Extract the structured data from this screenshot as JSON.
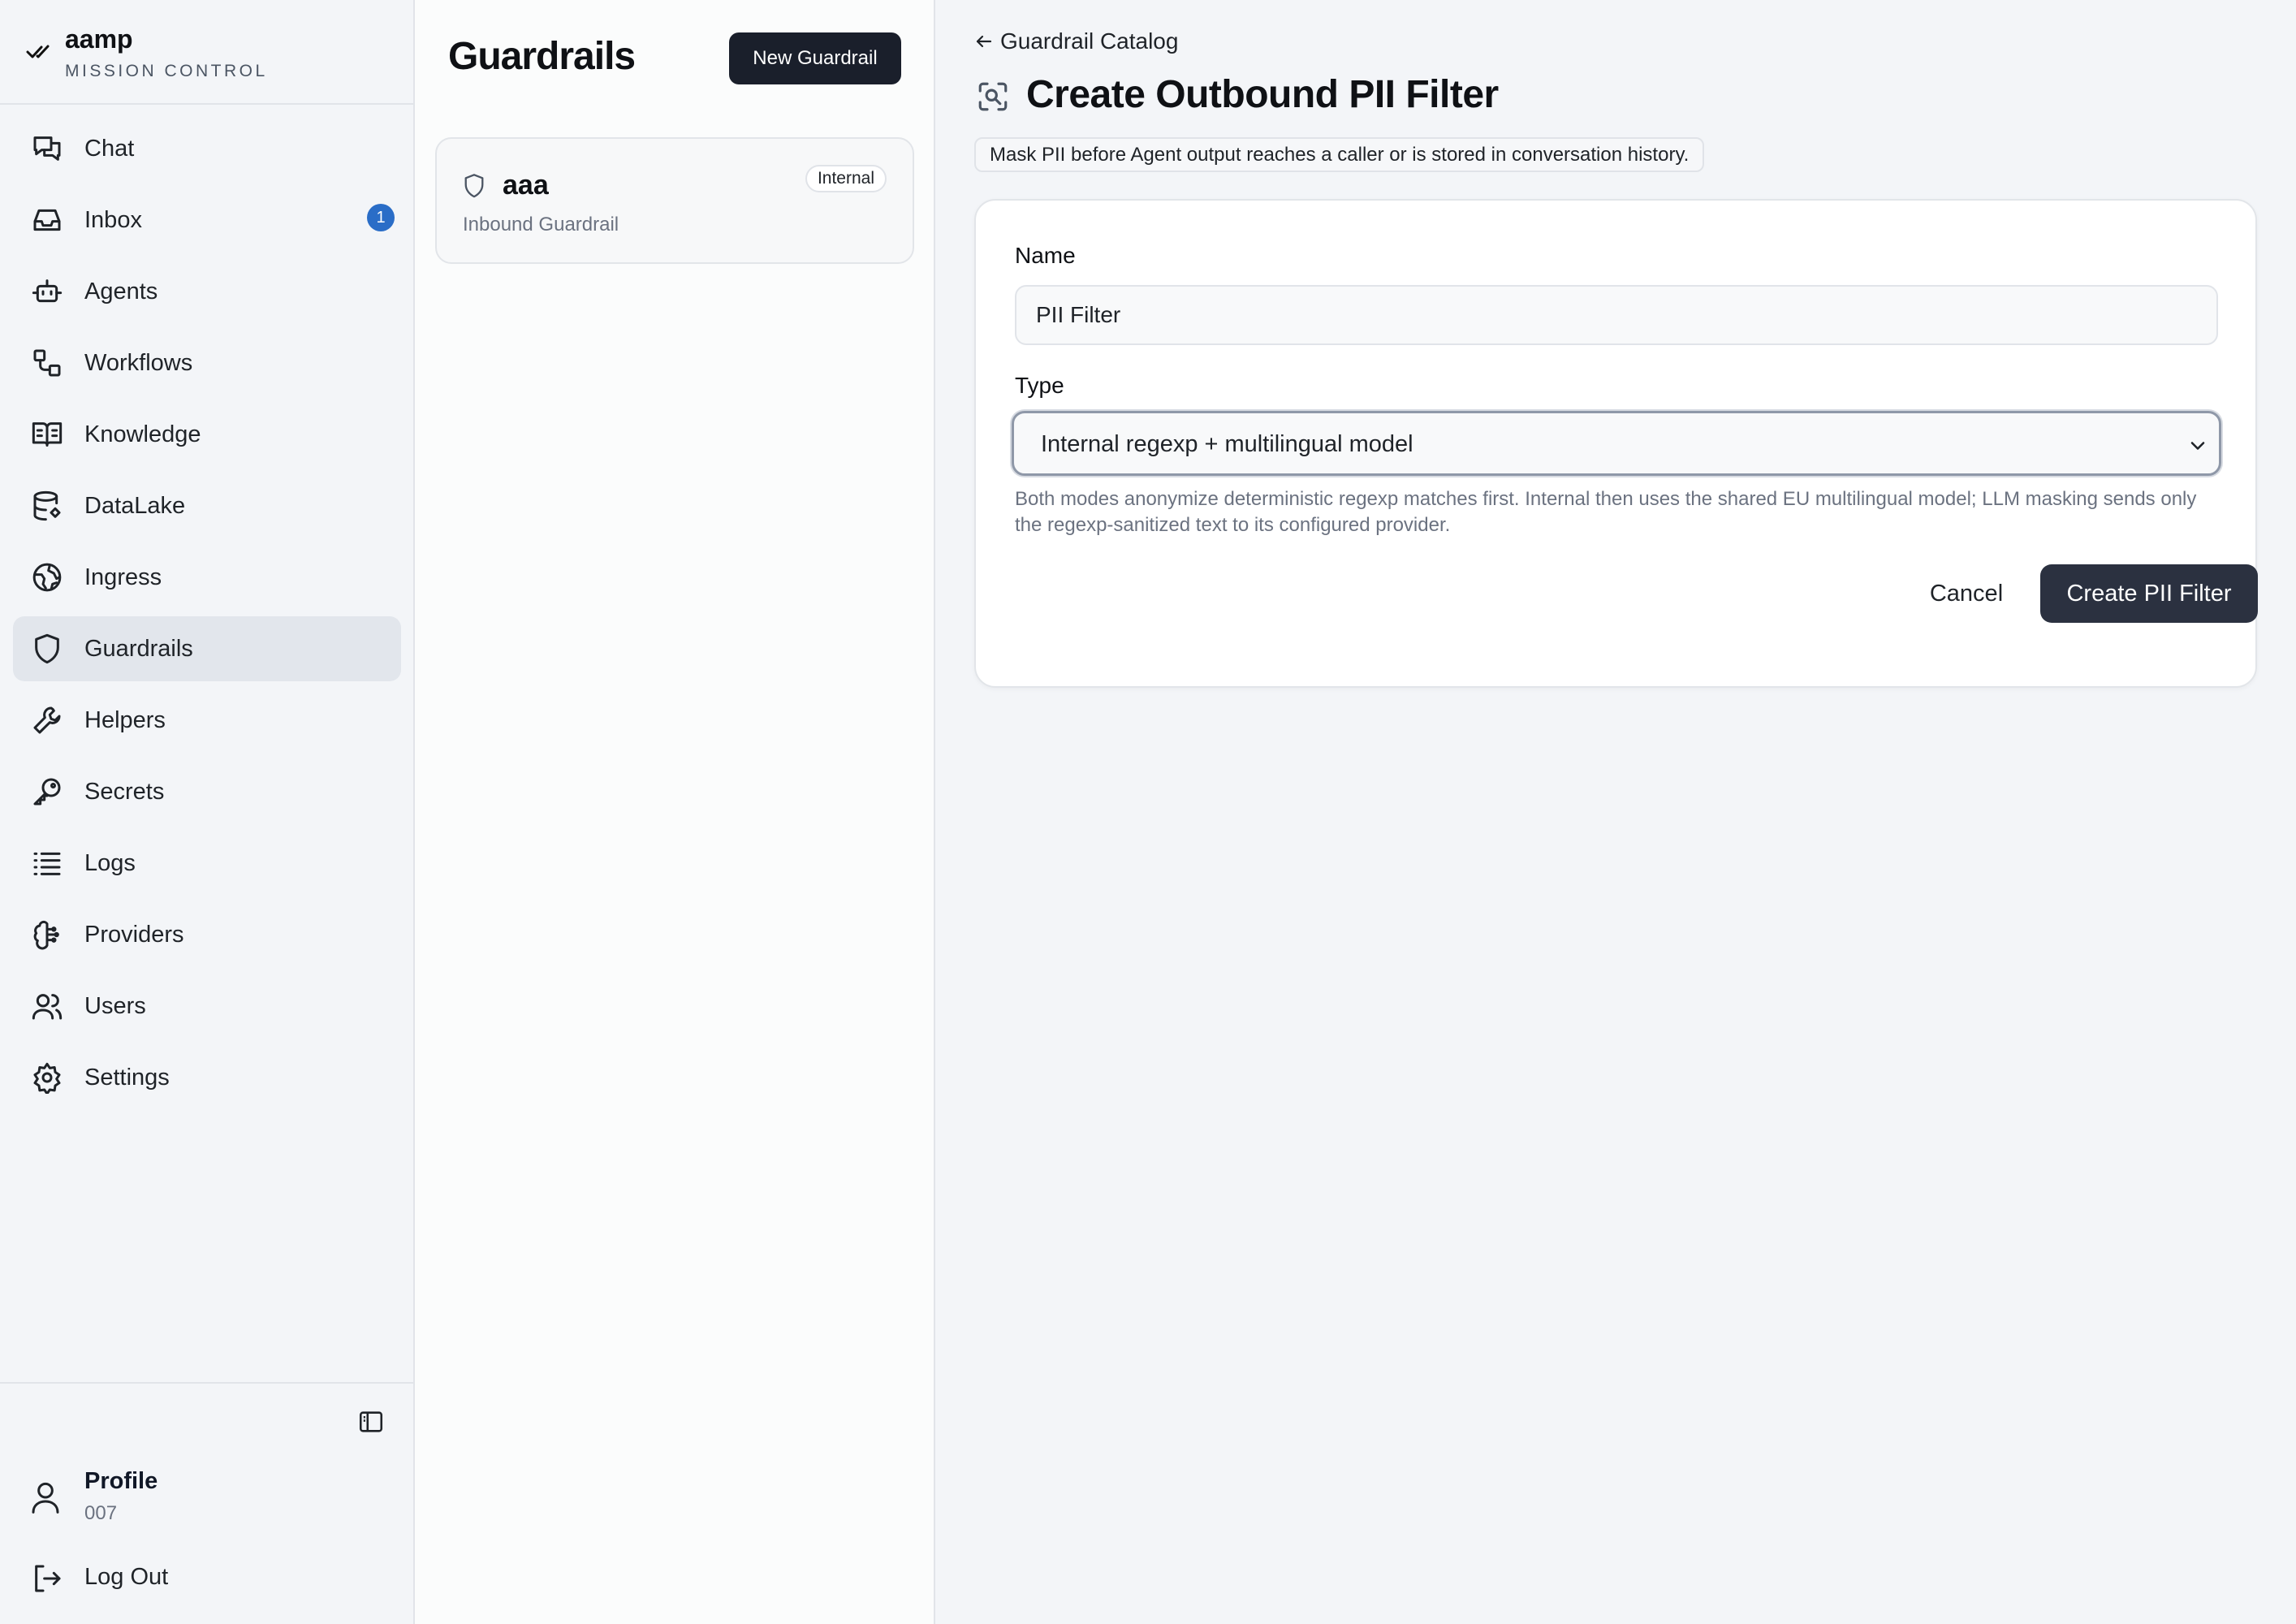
{
  "brand": {
    "name": "aamp",
    "subtitle": "MISSION CONTROL",
    "icon": "double-check-icon"
  },
  "sidebar": {
    "items": [
      {
        "label": "Chat",
        "icon": "chat-icon"
      },
      {
        "label": "Inbox",
        "icon": "inbox-icon",
        "badge": "1"
      },
      {
        "label": "Agents",
        "icon": "robot-icon"
      },
      {
        "label": "Workflows",
        "icon": "workflow-icon"
      },
      {
        "label": "Knowledge",
        "icon": "book-icon"
      },
      {
        "label": "DataLake",
        "icon": "database-icon"
      },
      {
        "label": "Ingress",
        "icon": "globe-icon"
      },
      {
        "label": "Guardrails",
        "icon": "shield-icon",
        "active": true
      },
      {
        "label": "Helpers",
        "icon": "wrench-icon"
      },
      {
        "label": "Secrets",
        "icon": "key-icon"
      },
      {
        "label": "Logs",
        "icon": "list-icon"
      },
      {
        "label": "Providers",
        "icon": "brain-icon"
      },
      {
        "label": "Users",
        "icon": "users-icon"
      },
      {
        "label": "Settings",
        "icon": "gear-icon"
      }
    ],
    "profile": {
      "label": "Profile",
      "sub": "007"
    },
    "logout_label": "Log Out"
  },
  "list_panel": {
    "title": "Guardrails",
    "new_button_label": "New Guardrail",
    "cards": [
      {
        "name": "aaa",
        "subtitle": "Inbound Guardrail",
        "badge": "Internal"
      }
    ]
  },
  "main": {
    "back_label": "Guardrail Catalog",
    "title": "Create Outbound PII Filter",
    "description": "Mask PII before Agent output reaches a caller or is stored in conversation history.",
    "form": {
      "name_label": "Name",
      "name_value": "PII Filter",
      "type_label": "Type",
      "type_value": "Internal regexp + multilingual model",
      "helper_text": "Both modes anonymize deterministic regexp matches first. Internal then uses the shared EU multilingual model; LLM masking sends only the regexp-sanitized text to its configured provider.",
      "cancel_label": "Cancel",
      "submit_label": "Create PII Filter"
    }
  },
  "colors": {
    "primary_button": "#1a1f2b",
    "badge_blue": "#2a6dc7",
    "active_nav": "#e2e6ec"
  }
}
